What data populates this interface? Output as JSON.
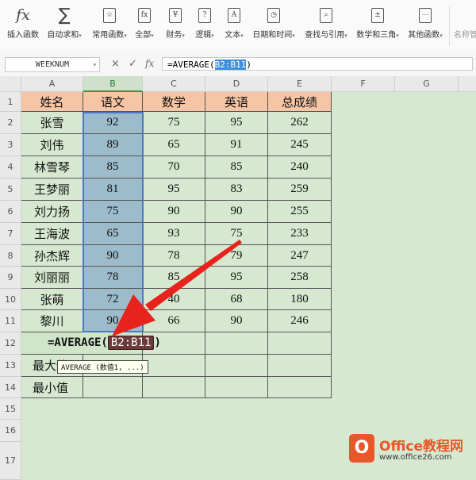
{
  "toolbar": {
    "items": [
      {
        "label": "插入函数",
        "icon": "fx",
        "caret": ""
      },
      {
        "label": "自动求和",
        "icon": "∑",
        "caret": "▾"
      },
      {
        "label": "常用函数",
        "icon": "☆",
        "caret": "▾"
      },
      {
        "label": "全部",
        "icon": "fx",
        "caret": "▾"
      },
      {
        "label": "财务",
        "icon": "¥",
        "caret": "▾"
      },
      {
        "label": "逻辑",
        "icon": "?",
        "caret": "▾"
      },
      {
        "label": "文本",
        "icon": "A",
        "caret": "▾"
      },
      {
        "label": "日期和时间",
        "icon": "◷",
        "caret": "▾"
      },
      {
        "label": "查找与引用",
        "icon": "⌕",
        "caret": "▾"
      },
      {
        "label": "数学和三角",
        "icon": "±",
        "caret": "▾"
      },
      {
        "label": "其他函数",
        "icon": "⋯",
        "caret": "▾"
      },
      {
        "label": "名称管",
        "icon": "",
        "caret": ""
      }
    ]
  },
  "formula_bar": {
    "name_box": "WEEKNUM",
    "cancel": "×",
    "confirm": "✓",
    "fx": "fx",
    "formula_prefix": "=AVERAGE(",
    "formula_range": "B2:B11",
    "formula_suffix": ")"
  },
  "columns": [
    "A",
    "B",
    "C",
    "D",
    "E",
    "F",
    "G"
  ],
  "rows": [
    "1",
    "2",
    "3",
    "4",
    "5",
    "6",
    "7",
    "8",
    "9",
    "10",
    "11",
    "12",
    "13",
    "14",
    "15",
    "16",
    "17"
  ],
  "table": {
    "headers": [
      "姓名",
      "语文",
      "数学",
      "英语",
      "总成绩"
    ],
    "data": [
      [
        "张雪",
        "92",
        "75",
        "95",
        "262"
      ],
      [
        "刘伟",
        "89",
        "65",
        "91",
        "245"
      ],
      [
        "林雪琴",
        "85",
        "70",
        "85",
        "240"
      ],
      [
        "王梦丽",
        "81",
        "95",
        "83",
        "259"
      ],
      [
        "刘力扬",
        "75",
        "90",
        "90",
        "255"
      ],
      [
        "王海波",
        "65",
        "93",
        "75",
        "233"
      ],
      [
        "孙杰辉",
        "90",
        "78",
        "79",
        "247"
      ],
      [
        "刘丽丽",
        "78",
        "85",
        "95",
        "258"
      ],
      [
        "张萌",
        "72",
        "40",
        "68",
        "180"
      ],
      [
        "黎川",
        "90",
        "66",
        "90",
        "246"
      ]
    ],
    "row13_label": "最大值",
    "row14_label": "最小值"
  },
  "cell_edit": {
    "prefix": "=AVERAGE(",
    "range": "B2:B11",
    "suffix": ")"
  },
  "tooltip": "AVERAGE (数值1, ...)",
  "watermark": {
    "brand": "Office教程网",
    "url": "www.office26.com"
  },
  "colors": {
    "header_fill": "#f6c5a6",
    "selected_fill": "#9dbccb",
    "sheet_bg": "#d6e8cf",
    "arrow": "#e8231e"
  }
}
